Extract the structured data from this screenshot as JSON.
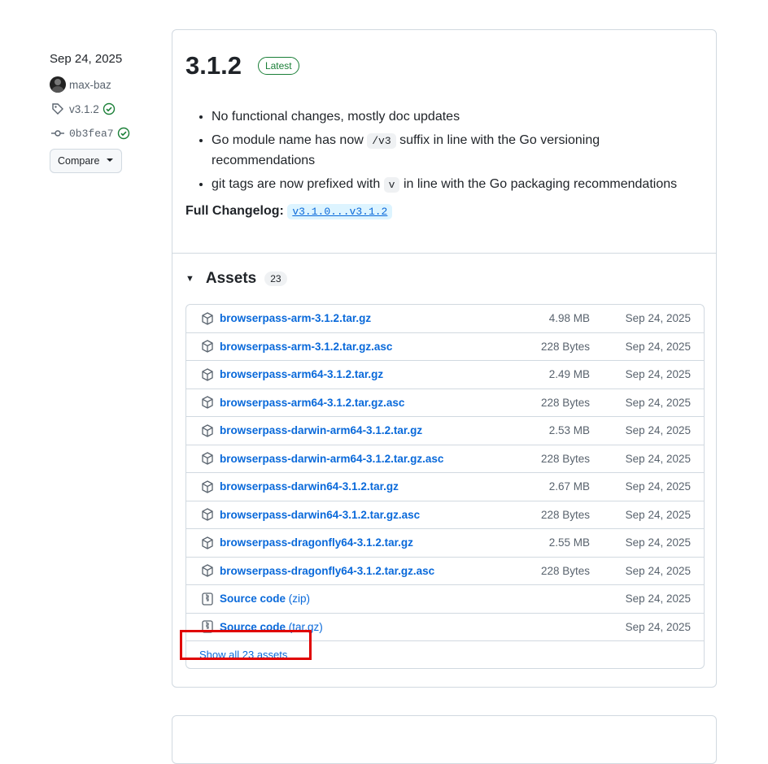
{
  "sidebar": {
    "date": "Sep 24, 2025",
    "author": "max-baz",
    "tag": "v3.1.2",
    "commit": "0b3fea7",
    "compare_label": "Compare"
  },
  "release": {
    "version": "3.1.2",
    "badge": "Latest",
    "notes": {
      "item1": "No functional changes, mostly doc updates",
      "item2_pre": "Go module name has now",
      "item2_code": "/v3",
      "item2_post": "suffix in line with the Go versioning recommendations",
      "item3_pre": "git tags are now prefixed with",
      "item3_code": "v",
      "item3_post": "in line with the Go packaging recommendations"
    },
    "changelog_label": "Full Changelog:",
    "changelog_link": "v3.1.0...v3.1.2"
  },
  "assets": {
    "title": "Assets",
    "count": "23",
    "rows": [
      {
        "name": "browserpass-arm-3.1.2.tar.gz",
        "size": "4.98 MB",
        "date": "Sep 24, 2025"
      },
      {
        "name": "browserpass-arm-3.1.2.tar.gz.asc",
        "size": "228 Bytes",
        "date": "Sep 24, 2025"
      },
      {
        "name": "browserpass-arm64-3.1.2.tar.gz",
        "size": "2.49 MB",
        "date": "Sep 24, 2025"
      },
      {
        "name": "browserpass-arm64-3.1.2.tar.gz.asc",
        "size": "228 Bytes",
        "date": "Sep 24, 2025"
      },
      {
        "name": "browserpass-darwin-arm64-3.1.2.tar.gz",
        "size": "2.53 MB",
        "date": "Sep 24, 2025"
      },
      {
        "name": "browserpass-darwin-arm64-3.1.2.tar.gz.asc",
        "size": "228 Bytes",
        "date": "Sep 24, 2025"
      },
      {
        "name": "browserpass-darwin64-3.1.2.tar.gz",
        "size": "2.67 MB",
        "date": "Sep 24, 2025"
      },
      {
        "name": "browserpass-darwin64-3.1.2.tar.gz.asc",
        "size": "228 Bytes",
        "date": "Sep 24, 2025"
      },
      {
        "name": "browserpass-dragonfly64-3.1.2.tar.gz",
        "size": "2.55 MB",
        "date": "Sep 24, 2025"
      },
      {
        "name": "browserpass-dragonfly64-3.1.2.tar.gz.asc",
        "size": "228 Bytes",
        "date": "Sep 24, 2025"
      }
    ],
    "source_zip": {
      "label": "Source code",
      "sub": "(zip)",
      "date": "Sep 24, 2025"
    },
    "source_tar": {
      "label": "Source code",
      "sub": "(tar.gz)",
      "date": "Sep 24, 2025"
    },
    "show_all": "Show all 23 assets"
  },
  "colors": {
    "link": "#0969da",
    "verified": "#1a7f37",
    "highlight": "#e00000"
  }
}
